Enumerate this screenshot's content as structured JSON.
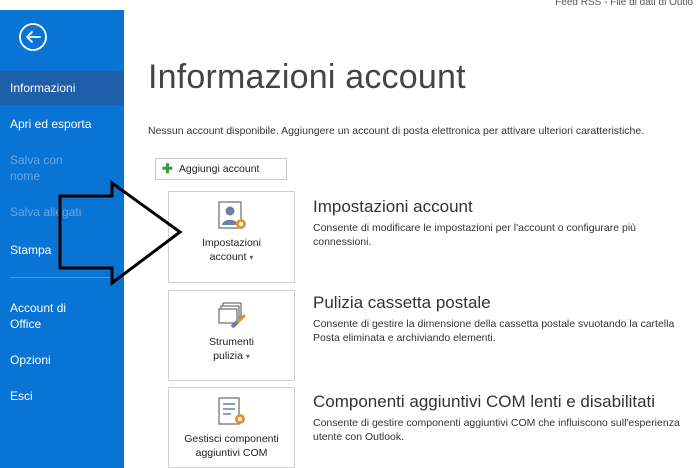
{
  "window": {
    "title_fragment": "Feed RSS - File di dati di Outlo"
  },
  "sidebar": {
    "back_label": "back",
    "items": [
      {
        "label": "Informazioni",
        "state": "active"
      },
      {
        "label": "Apri ed esporta",
        "state": "normal"
      },
      {
        "label": "Salva con nome",
        "state": "disabled"
      },
      {
        "label": "Salva allegati",
        "state": "disabled"
      },
      {
        "label": "Stampa",
        "state": "normal"
      },
      {
        "label": "Account di Office",
        "state": "normal"
      },
      {
        "label": "Opzioni",
        "state": "normal"
      },
      {
        "label": "Esci",
        "state": "normal"
      }
    ]
  },
  "main": {
    "title": "Informazioni account",
    "note": "Nessun account disponibile. Aggiungere un account di posta elettronica per attivare ulteriori caratteristiche.",
    "add_account_label": "Aggiungi account",
    "sections": [
      {
        "tile_line1": "Impostazioni",
        "tile_line2": "account",
        "icon": "account-settings-icon",
        "title": "Impostazioni account",
        "description": "Consente di modificare le impostazioni per l'account o configurare più connessioni."
      },
      {
        "tile_line1": "Strumenti",
        "tile_line2": "pulizia",
        "icon": "cleanup-tools-icon",
        "title": "Pulizia cassetta postale",
        "description": "Consente di gestire la dimensione della cassetta postale svuotando la cartella Posta eliminata e archiviando elementi."
      },
      {
        "tile_line1": "Gestisci componenti",
        "tile_line2": "aggiuntivi COM",
        "icon": "com-addins-icon",
        "title": "Componenti aggiuntivi COM lenti e disabilitati",
        "description": "Consente di gestire componenti aggiuntivi COM che influiscono sull'esperienza utente con Outlook."
      }
    ]
  },
  "colors": {
    "sidebar": "#0a74d4",
    "sidebar_active": "#1f5ea8",
    "sidebar_disabled_text": "#6aa6e2",
    "accent_orange": "#e8912d",
    "add_green": "#3c9a3c"
  }
}
